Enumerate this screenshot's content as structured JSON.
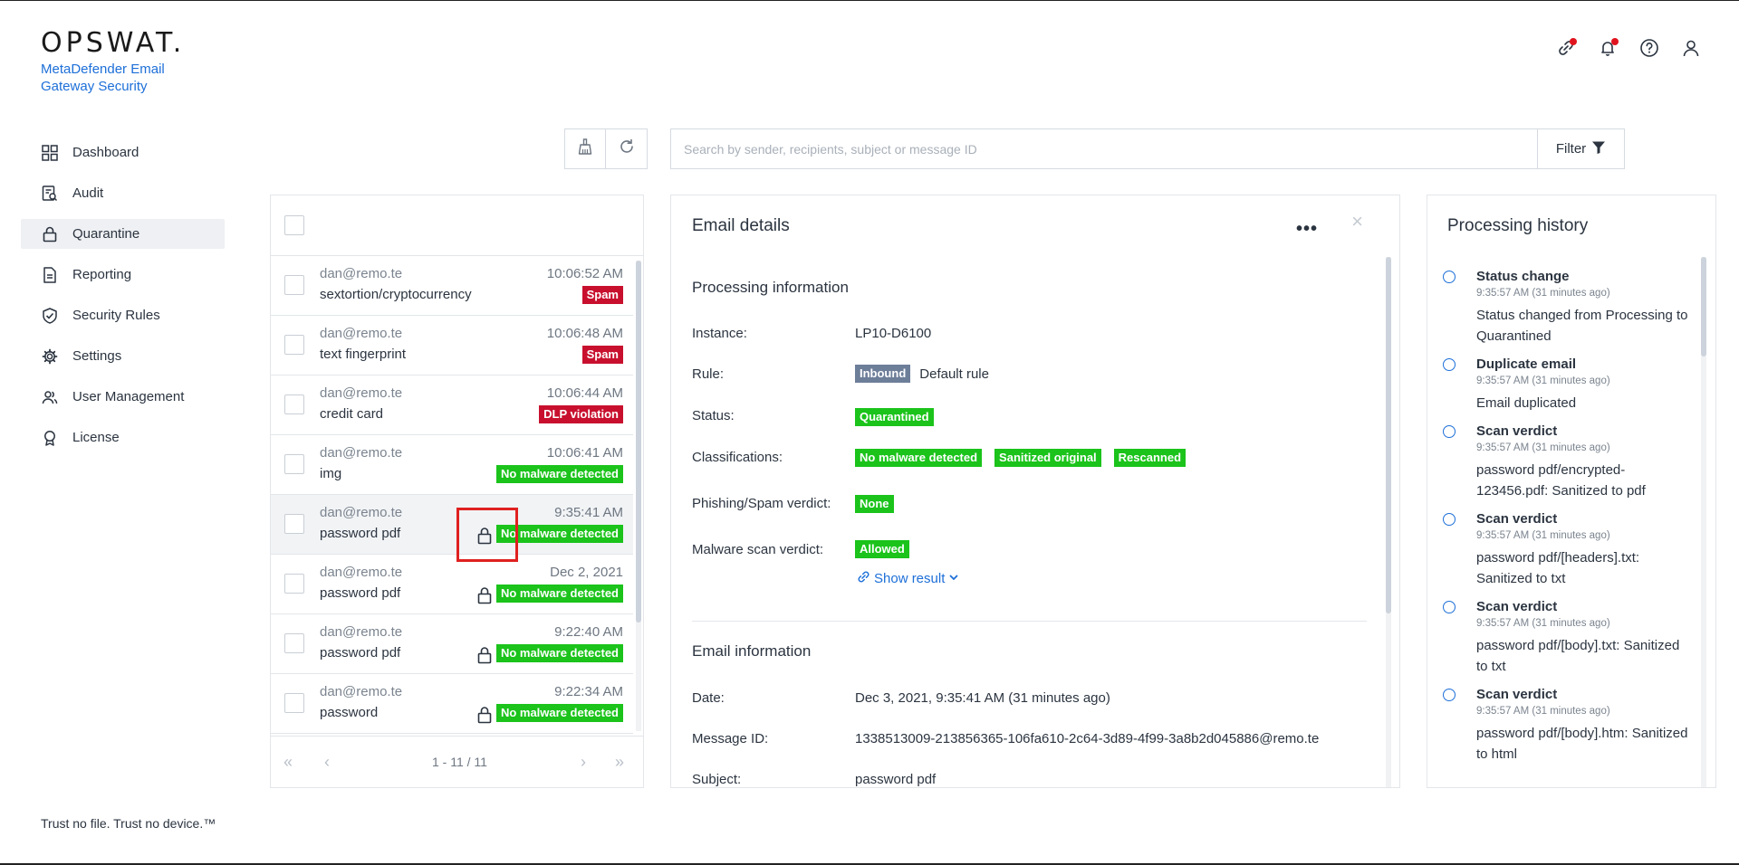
{
  "brand": {
    "logo_text": "OPSWAT.",
    "product_line1": "MetaDefender Email",
    "product_line2": "Gateway Security"
  },
  "header_icons": [
    "link-icon",
    "bell-icon",
    "help-icon",
    "user-icon"
  ],
  "sidebar": {
    "items": [
      {
        "label": "Dashboard",
        "icon": "dashboard-icon"
      },
      {
        "label": "Audit",
        "icon": "audit-icon"
      },
      {
        "label": "Quarantine",
        "icon": "lock-icon",
        "active": true
      },
      {
        "label": "Reporting",
        "icon": "document-icon"
      },
      {
        "label": "Security Rules",
        "icon": "shield-check-icon"
      },
      {
        "label": "Settings",
        "icon": "gear-icon"
      },
      {
        "label": "User Management",
        "icon": "users-icon"
      },
      {
        "label": "License",
        "icon": "award-icon"
      }
    ],
    "footer": "Trust no file. Trust no device.™"
  },
  "toolbar": {
    "search_placeholder": "Search by sender, recipients, subject or message ID",
    "filter_label": "Filter"
  },
  "email_list": {
    "rows": [
      {
        "sender": "dan@remo.te",
        "subject": "sextortion/cryptocurrency",
        "time": "10:06:52 AM",
        "badge": "Spam",
        "badge_color": "red",
        "locked": false
      },
      {
        "sender": "dan@remo.te",
        "subject": "text fingerprint",
        "time": "10:06:48 AM",
        "badge": "Spam",
        "badge_color": "red",
        "locked": false
      },
      {
        "sender": "dan@remo.te",
        "subject": "credit card",
        "time": "10:06:44 AM",
        "badge": "DLP violation",
        "badge_color": "red",
        "locked": false
      },
      {
        "sender": "dan@remo.te",
        "subject": "img",
        "time": "10:06:41 AM",
        "badge": "No malware detected",
        "badge_color": "green",
        "locked": false
      },
      {
        "sender": "dan@remo.te",
        "subject": "password pdf",
        "time": "9:35:41 AM",
        "badge": "No malware detected",
        "badge_color": "green",
        "locked": true,
        "selected": true
      },
      {
        "sender": "dan@remo.te",
        "subject": "password pdf",
        "time": "Dec 2, 2021",
        "badge": "No malware detected",
        "badge_color": "green",
        "locked": true
      },
      {
        "sender": "dan@remo.te",
        "subject": "password pdf",
        "time": "9:22:40 AM",
        "badge": "No malware detected",
        "badge_color": "green",
        "locked": true
      },
      {
        "sender": "dan@remo.te",
        "subject": "password",
        "time": "9:22:34 AM",
        "badge": "No malware detected",
        "badge_color": "green",
        "locked": true
      }
    ],
    "pager": {
      "first": "«",
      "prev": "‹",
      "count": "1 - 11 / 11",
      "next": "›",
      "last": "»"
    }
  },
  "details": {
    "title": "Email details",
    "more": "•••",
    "close": "×",
    "processing_title": "Processing information",
    "instance_label": "Instance:",
    "instance_value": "LP10-D6100",
    "rule_label": "Rule:",
    "rule_badge": "Inbound",
    "rule_value": "Default rule",
    "status_label": "Status:",
    "status_badge": "Quarantined",
    "classifications_label": "Classifications:",
    "classifications": [
      "No malware detected",
      "Sanitized original",
      "Rescanned"
    ],
    "phishing_label": "Phishing/Spam verdict:",
    "phishing_badge": "None",
    "malware_label": "Malware scan verdict:",
    "malware_badge": "Allowed",
    "show_result": "Show result",
    "email_info_title": "Email information",
    "date_label": "Date:",
    "date_value": "Dec 3, 2021, 9:35:41 AM (31 minutes ago)",
    "message_id_label": "Message ID:",
    "message_id_value": "1338513009-213856365-106fa610-2c64-3d89-4f99-3a8b2d045886@remo.te",
    "subject_label": "Subject:",
    "subject_value": "password pdf"
  },
  "history": {
    "title": "Processing history",
    "items": [
      {
        "title": "Status change",
        "time": "9:35:57 AM (31 minutes ago)",
        "desc": "Status changed from Processing to Quarantined"
      },
      {
        "title": "Duplicate email",
        "time": "9:35:57 AM (31 minutes ago)",
        "desc": "Email duplicated"
      },
      {
        "title": "Scan verdict",
        "time": "9:35:57 AM (31 minutes ago)",
        "desc": "password pdf/encrypted-123456.pdf: Sanitized to pdf"
      },
      {
        "title": "Scan verdict",
        "time": "9:35:57 AM (31 minutes ago)",
        "desc": "password pdf/[headers].txt: Sanitized to txt"
      },
      {
        "title": "Scan verdict",
        "time": "9:35:57 AM (31 minutes ago)",
        "desc": "password pdf/[body].txt: Sanitized to txt"
      },
      {
        "title": "Scan verdict",
        "time": "9:35:57 AM (31 minutes ago)",
        "desc": "password pdf/[body].htm: Sanitized to html"
      }
    ]
  },
  "colors": {
    "accent": "#1d6fd8",
    "danger": "#c8102e",
    "success": "#1bc31b",
    "slate": "#6d7e99",
    "highlight": "#e02020"
  }
}
